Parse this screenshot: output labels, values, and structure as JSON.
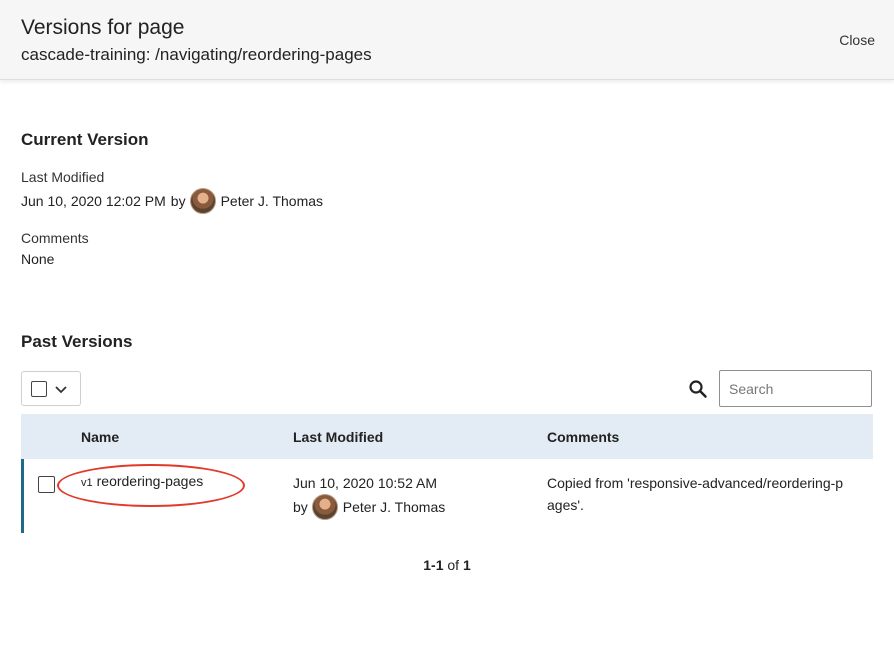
{
  "header": {
    "title": "Versions for page",
    "subtitle": "cascade-training: /navigating/reordering-pages",
    "close_label": "Close"
  },
  "current_version": {
    "section_title": "Current Version",
    "last_modified_label": "Last Modified",
    "last_modified_value": "Jun 10, 2020 12:02 PM",
    "by_label": "by",
    "author": "Peter J. Thomas",
    "comments_label": "Comments",
    "comments_value": "None"
  },
  "past_versions": {
    "section_title": "Past Versions",
    "search": {
      "placeholder": "Search",
      "value": ""
    },
    "columns": [
      "Name",
      "Last Modified",
      "Comments"
    ],
    "rows": [
      {
        "version": "v1",
        "name": "reordering-pages",
        "date": "Jun 10, 2020 10:52 AM",
        "by_label": "by",
        "author": "Peter J. Thomas",
        "comment_line1": "Copied from 'responsive-advanced/reordering-p",
        "comment_line2": "ages'."
      }
    ],
    "pager": {
      "range": "1-1",
      "of": "of",
      "total": "1"
    }
  },
  "icons": {
    "checkbox": "checkbox-icon",
    "chevron": "chevron-down-icon",
    "search": "search-icon",
    "avatar": "avatar-image"
  },
  "colors": {
    "header_bg": "#f6f6f7",
    "table_header_bg": "#e3ecf5",
    "row_accent": "#1d6a8c",
    "annotation_red": "#e23a2a"
  }
}
